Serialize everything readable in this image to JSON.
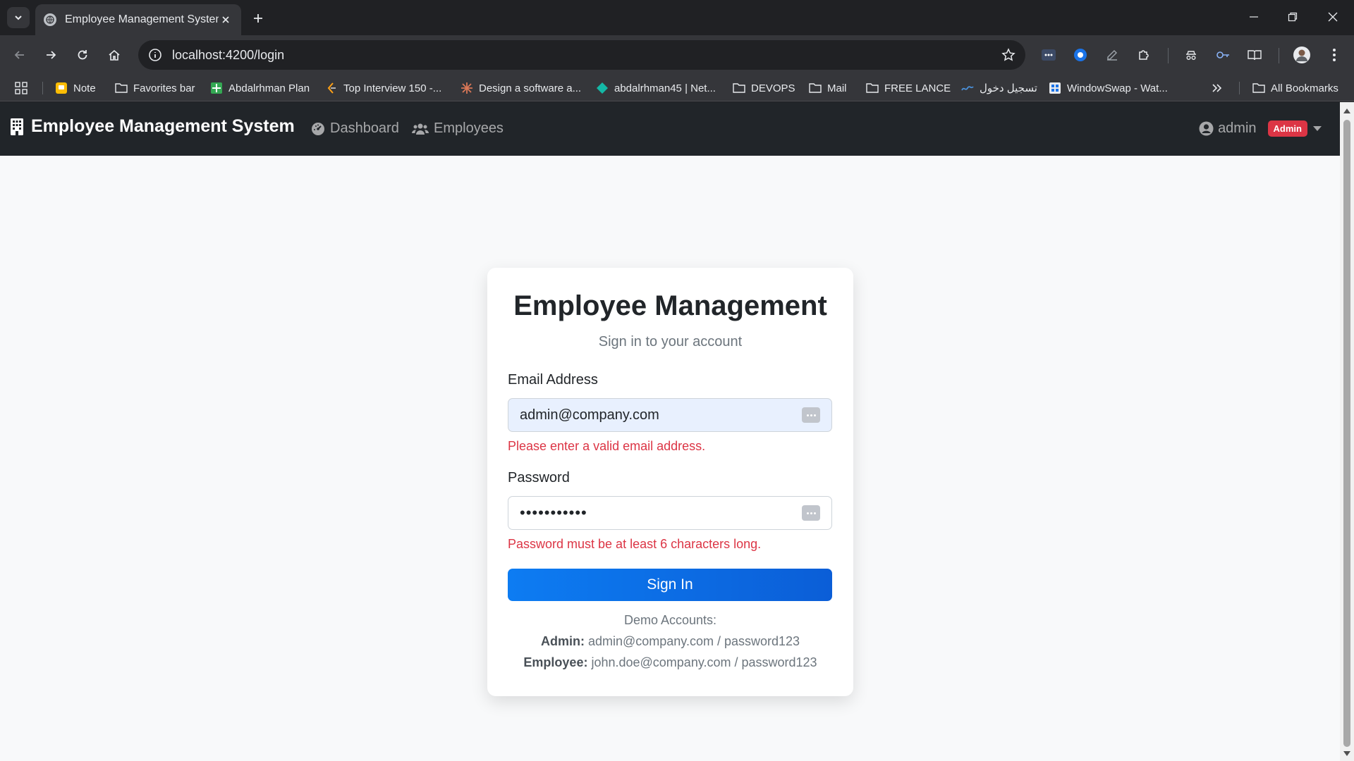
{
  "browser": {
    "tab_title": "Employee Management System",
    "url": "localhost:4200/login",
    "bookmarks": [
      {
        "label": "Note",
        "icon": "note-icon"
      },
      {
        "label": "Favorites bar",
        "icon": "folder-icon"
      },
      {
        "label": "Abdalrhman Plan",
        "icon": "sheets-icon"
      },
      {
        "label": "Top Interview 150 -...",
        "icon": "leetcode-icon"
      },
      {
        "label": "Design a software a...",
        "icon": "claude-icon"
      },
      {
        "label": "abdalrhman45 | Net...",
        "icon": "diamond-icon"
      },
      {
        "label": "DEVOPS",
        "icon": "folder-icon"
      },
      {
        "label": "Mail",
        "icon": "folder-icon"
      },
      {
        "label": "FREE LANCE",
        "icon": "folder-icon"
      },
      {
        "label": "تسجيل دخول",
        "icon": "site-icon"
      },
      {
        "label": "WindowSwap - Wat...",
        "icon": "window-icon"
      }
    ],
    "all_bookmarks": "All Bookmarks"
  },
  "app_nav": {
    "brand": "Employee Management System",
    "links": [
      {
        "label": "Dashboard",
        "icon": "dashboard-icon"
      },
      {
        "label": "Employees",
        "icon": "users-icon"
      }
    ],
    "user": "admin",
    "role": "Admin"
  },
  "login": {
    "title": "Employee Management",
    "subtitle": "Sign in to your account",
    "email_label": "Email Address",
    "email_value": "admin@company.com",
    "email_error": "Please enter a valid email address.",
    "password_label": "Password",
    "password_value": "•••••••••••",
    "password_error": "Password must be at least 6 characters long.",
    "submit": "Sign In",
    "demo_heading": "Demo Accounts:",
    "demo_admin_label": "Admin:",
    "demo_admin_value": " admin@company.com / password123",
    "demo_employee_label": "Employee:",
    "demo_employee_value": " john.doe@company.com / password123"
  },
  "colors": {
    "navbar": "#212529",
    "primary": "#0d6efd",
    "danger": "#dc3545",
    "autofill": "#e8f0fe"
  }
}
